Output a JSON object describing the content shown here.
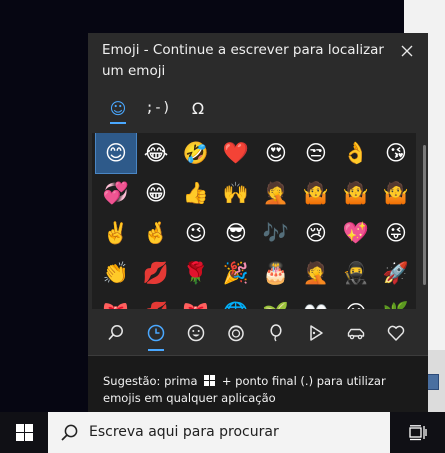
{
  "panel": {
    "title": "Emoji - Continue a escrever para localizar um emoji",
    "top_tabs": [
      {
        "icon": "smiley-icon",
        "label": "☺",
        "active": true
      },
      {
        "icon": "kaomoji-icon",
        "label": ";-)",
        "active": false
      },
      {
        "icon": "symbols-omega-icon",
        "label": "Ω",
        "active": false
      }
    ],
    "emoji_grid": [
      "😊",
      "😂",
      "🤣",
      "❤️",
      "😍",
      "😒",
      "👌",
      "😘",
      "💞",
      "😁",
      "👍",
      "🙌",
      "🤦",
      "🤷",
      "🤷",
      "🤷",
      "✌️",
      "🤞",
      "😉",
      "😎",
      "🎶",
      "😢",
      "💖",
      "😜",
      "👏",
      "💋",
      "🌹",
      "🎉",
      "🎂",
      "🤦",
      "🥷",
      "🚀",
      "🎀",
      "💋",
      "🎀",
      "🌐",
      "🌱",
      "👀",
      "😐",
      "🌿"
    ],
    "bottom_tabs": [
      {
        "icon": "search-icon",
        "active": false
      },
      {
        "icon": "recent-clock-icon",
        "active": true
      },
      {
        "icon": "smiley-face-icon",
        "active": false
      },
      {
        "icon": "people-icon",
        "active": false
      },
      {
        "icon": "celebration-balloon-icon",
        "active": false
      },
      {
        "icon": "food-pizza-icon",
        "active": false
      },
      {
        "icon": "travel-car-icon",
        "active": false
      },
      {
        "icon": "heart-symbols-icon",
        "active": false
      }
    ],
    "tip_before": "Sugestão: prima",
    "tip_after": "+ ponto final (.) para utilizar emojis em qualquer aplicação"
  },
  "taskbar": {
    "search_placeholder": "Escreva aqui para procurar"
  },
  "colors": {
    "accent": "#4aa8ff",
    "panel_bg": "#2b2b2b",
    "selected_cell": "#2e5a8a"
  }
}
